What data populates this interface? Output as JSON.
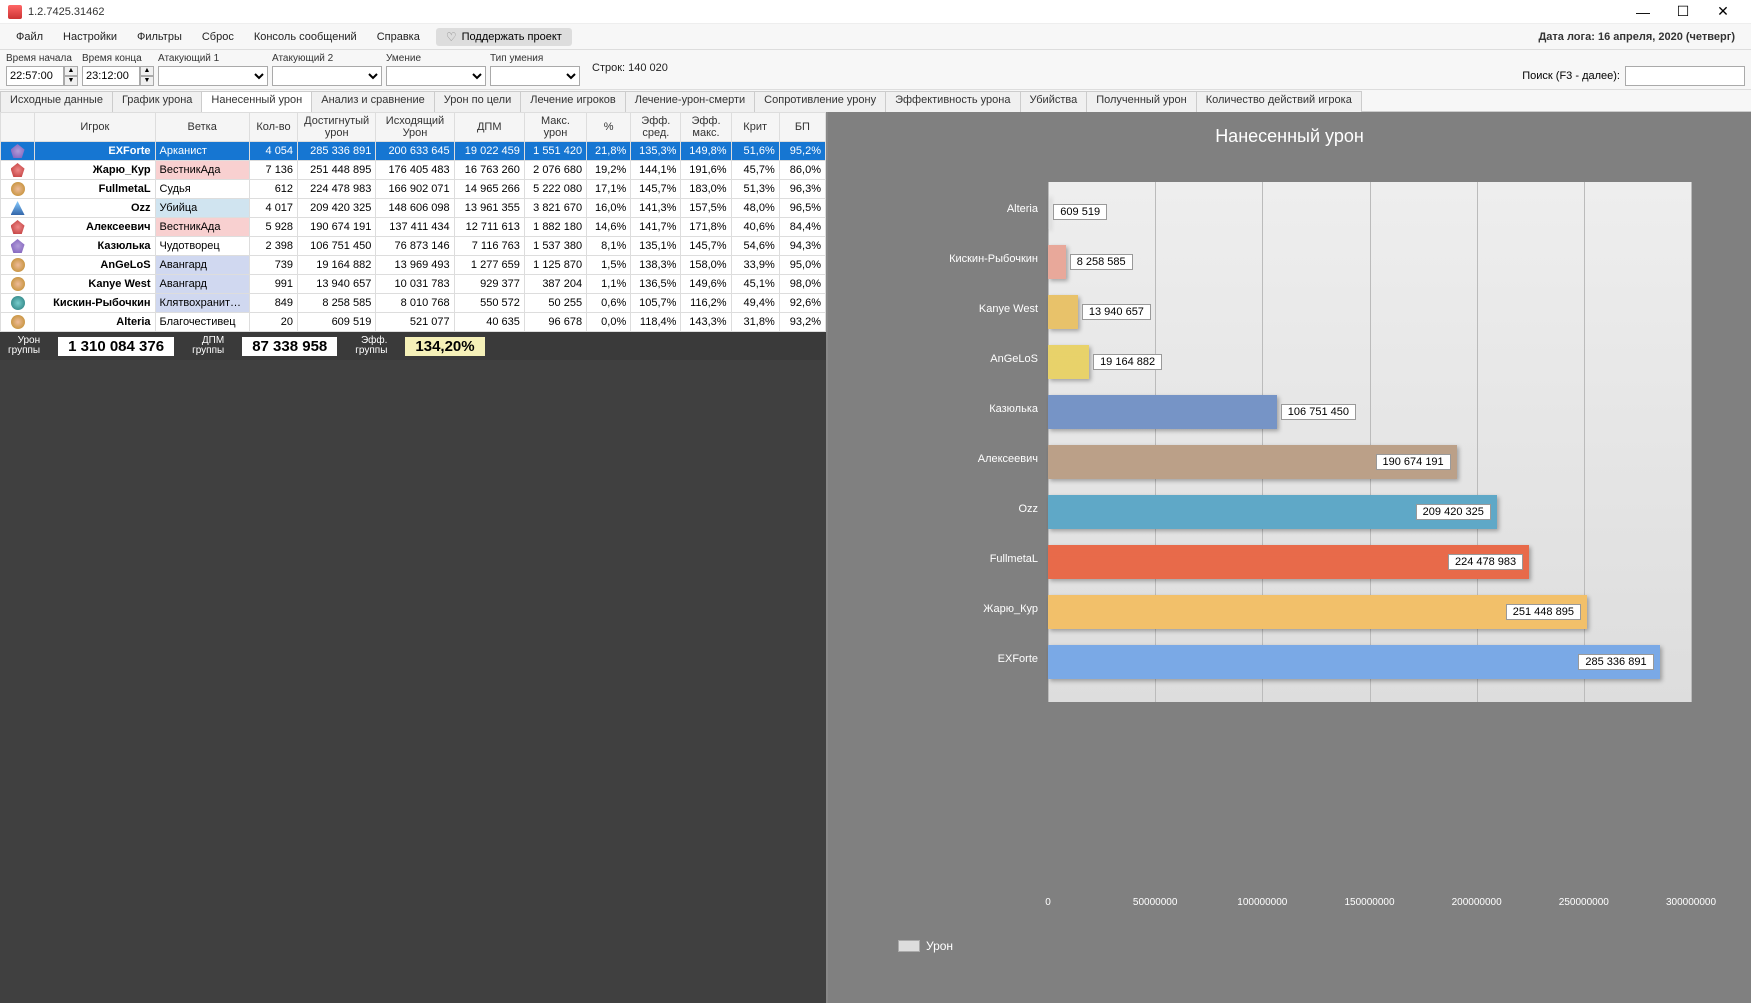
{
  "titlebar": {
    "title": "1.2.7425.31462"
  },
  "menu": {
    "file": "Файл",
    "settings": "Настройки",
    "filters": "Фильтры",
    "reset": "Сброс",
    "console": "Консоль сообщений",
    "help": "Справка",
    "support": "Поддержать проект"
  },
  "logdate": "Дата лога: 16 апреля, 2020  (четверг)",
  "filters": {
    "timeStartLabel": "Время начала",
    "timeStart": "22:57:00",
    "timeEndLabel": "Время конца",
    "timeEnd": "23:12:00",
    "atk1Label": "Атакующий 1",
    "atk2Label": "Атакующий 2",
    "skillLabel": "Умение",
    "skillTypeLabel": "Тип умения",
    "rows": "Строк: 140 020",
    "searchLabel": "Поиск (F3 - далее):"
  },
  "tabs": [
    "Исходные данные",
    "График урона",
    "Нанесенный урон",
    "Анализ и сравнение",
    "Урон по цели",
    "Лечение игроков",
    "Лечение-урон-смерти",
    "Сопротивление урону",
    "Эффективность урона",
    "Убийства",
    "Полученный урон",
    "Количество действий игрока"
  ],
  "activeTab": 2,
  "columns": [
    "",
    "Игрок",
    "Ветка",
    "Кол-во",
    "Достигнутый урон",
    "Исходящий Урон",
    "ДПМ",
    "Макс. урон",
    "%",
    "Эфф. сред.",
    "Эфф. макс.",
    "Крит",
    "БП"
  ],
  "rows": [
    {
      "ic": "purple",
      "p": "EXForte",
      "b": "Арканист",
      "c": "4 054",
      "du": "285 336 891",
      "iu": "200 633 645",
      "dpm": "19 022 459",
      "mx": "1 551 420",
      "pc": "21,8%",
      "es": "135,3%",
      "em": "149,8%",
      "kr": "51,6%",
      "bp": "95,2%",
      "sel": true
    },
    {
      "ic": "red",
      "p": "Жарю_Кур",
      "b": "ВестникАда",
      "c": "7 136",
      "du": "251 448 895",
      "iu": "176 405 483",
      "dpm": "16 763 260",
      "mx": "2 076 680",
      "pc": "19,2%",
      "es": "144,1%",
      "em": "191,6%",
      "kr": "45,7%",
      "bp": "86,0%",
      "cls": "pink"
    },
    {
      "ic": "gold",
      "p": "FullmetaL",
      "b": "Судья",
      "c": "612",
      "du": "224 478 983",
      "iu": "166 902 071",
      "dpm": "14 965 266",
      "mx": "5 222 080",
      "pc": "17,1%",
      "es": "145,7%",
      "em": "183,0%",
      "kr": "51,3%",
      "bp": "96,3%"
    },
    {
      "ic": "blue",
      "p": "Ozz",
      "b": "Убийца",
      "c": "4 017",
      "du": "209 420 325",
      "iu": "148 606 098",
      "dpm": "13 961 355",
      "mx": "3 821 670",
      "pc": "16,0%",
      "es": "141,3%",
      "em": "157,5%",
      "kr": "48,0%",
      "bp": "96,5%",
      "cls": "lblue"
    },
    {
      "ic": "red",
      "p": "Алексеевич",
      "b": "ВестникАда",
      "c": "5 928",
      "du": "190 674 191",
      "iu": "137 411 434",
      "dpm": "12 711 613",
      "mx": "1 882 180",
      "pc": "14,6%",
      "es": "141,7%",
      "em": "171,8%",
      "kr": "40,6%",
      "bp": "84,4%",
      "cls": "pink"
    },
    {
      "ic": "purple",
      "p": "Казюлька",
      "b": "Чудотворец",
      "c": "2 398",
      "du": "106 751 450",
      "iu": "76 873 146",
      "dpm": "7 116 763",
      "mx": "1 537 380",
      "pc": "8,1%",
      "es": "135,1%",
      "em": "145,7%",
      "kr": "54,6%",
      "bp": "94,3%"
    },
    {
      "ic": "gold",
      "p": "AnGeLoS",
      "b": "Авангард",
      "c": "739",
      "du": "19 164 882",
      "iu": "13 969 493",
      "dpm": "1 277 659",
      "mx": "1 125 870",
      "pc": "1,5%",
      "es": "138,3%",
      "em": "158,0%",
      "kr": "33,9%",
      "bp": "95,0%",
      "cls": "blue"
    },
    {
      "ic": "gold",
      "p": "Kanye West",
      "b": "Авангард",
      "c": "991",
      "du": "13 940 657",
      "iu": "10 031 783",
      "dpm": "929 377",
      "mx": "387 204",
      "pc": "1,1%",
      "es": "136,5%",
      "em": "149,6%",
      "kr": "45,1%",
      "bp": "98,0%",
      "cls": "blue"
    },
    {
      "ic": "teal",
      "p": "Кискин-Рыбочкин",
      "b": "Клятвохранитель",
      "c": "849",
      "du": "8 258 585",
      "iu": "8 010 768",
      "dpm": "550 572",
      "mx": "50 255",
      "pc": "0,6%",
      "es": "105,7%",
      "em": "116,2%",
      "kr": "49,4%",
      "bp": "92,6%",
      "cls": "blue"
    },
    {
      "ic": "gold",
      "p": "Alteria",
      "b": "Благочестивец",
      "c": "20",
      "du": "609 519",
      "iu": "521 077",
      "dpm": "40 635",
      "mx": "96 678",
      "pc": "0,0%",
      "es": "118,4%",
      "em": "143,3%",
      "kr": "31,8%",
      "bp": "93,2%"
    }
  ],
  "summary": {
    "dmgLabel": "Урон\nгруппы",
    "dmg": "1 310 084 376",
    "dpmLabel": "ДПМ\nгруппы",
    "dpm": "87 338 958",
    "effLabel": "Эфф.\nгруппы",
    "eff": "134,20%"
  },
  "chart": {
    "title": "Нанесенный урон",
    "legend": "Урон",
    "xticks": [
      "0",
      "50000000",
      "100000000",
      "150000000",
      "200000000",
      "250000000",
      "300000000"
    ]
  },
  "chart_data": {
    "type": "bar",
    "orientation": "horizontal",
    "title": "Нанесенный урон",
    "xlabel": "",
    "ylabel": "",
    "xlim": [
      0,
      300000000
    ],
    "categories": [
      "Alteria",
      "Кискин-Рыбочкин",
      "Kanye West",
      "AnGeLoS",
      "Казюлька",
      "Алексеевич",
      "Ozz",
      "FullmetaL",
      "Жарю_Кур",
      "EXForte"
    ],
    "values": [
      609519,
      8258585,
      13940657,
      19164882,
      106751450,
      190674191,
      209420325,
      224478983,
      251448895,
      285336891
    ],
    "colors": [
      "#bbbbbb",
      "#e8a89a",
      "#e8c26a",
      "#e8d26a",
      "#7694c6",
      "#bba088",
      "#5fa8c7",
      "#e86a4a",
      "#f2c06a",
      "#7aa9e6"
    ],
    "legend": [
      "Урон"
    ]
  }
}
